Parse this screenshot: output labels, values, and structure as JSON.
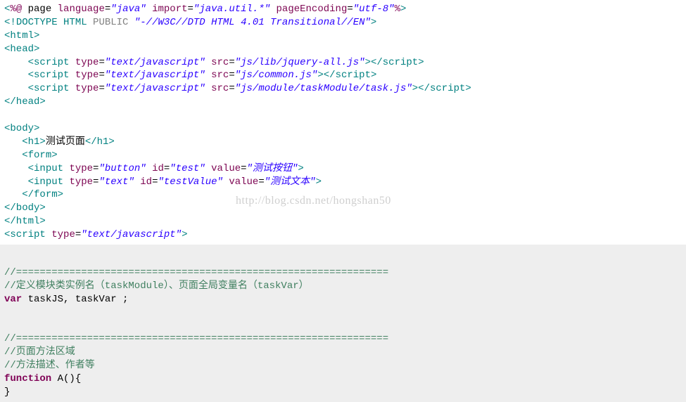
{
  "watermark": "http://blog.csdn.net/hongshan50",
  "jsp": {
    "line1": {
      "lt": "<",
      "pct": "%",
      "at": "@",
      "page_kw": " page ",
      "lang_attr": "language",
      "eq1": "=",
      "lang_val": "\"java\"",
      "import_attr": " import",
      "eq2": "=",
      "import_val": "\"java.util.*\"",
      "enc_attr": " pageEncoding",
      "eq3": "=",
      "enc_val": "\"utf-8\"",
      "pct2": "%",
      "gt": ">"
    },
    "line2": {
      "open": "<!",
      "doctype_kw": "DOCTYPE HTML",
      "public_kw": " PUBLIC ",
      "dtd": "\"-//W3C//DTD HTML 4.01 Transitional//EN\"",
      "close": ">"
    },
    "html_open": "<html>",
    "head_open": "<head>",
    "scripts": [
      {
        "indent": "    ",
        "open": "<",
        "tag": "script",
        "sp1": " ",
        "type_attr": "type",
        "eq1": "=",
        "type_val": "\"text/javascript\"",
        "sp2": " ",
        "src_attr": "src",
        "eq2": "=",
        "src_val": "\"js/lib/jquery-all.js\"",
        "close": "></",
        "tag2": "script",
        "gt": ">"
      },
      {
        "indent": "    ",
        "open": "<",
        "tag": "script",
        "sp1": " ",
        "type_attr": "type",
        "eq1": "=",
        "type_val": "\"text/javascript\"",
        "sp2": " ",
        "src_attr": "src",
        "eq2": "=",
        "src_val": "\"js/common.js\"",
        "close": "></",
        "tag2": "script",
        "gt": ">"
      },
      {
        "indent": "    ",
        "open": "<",
        "tag": "script",
        "sp1": " ",
        "type_attr": "type",
        "eq1": "=",
        "type_val": "\"text/javascript\"",
        "sp2": " ",
        "src_attr": "src",
        "eq2": "=",
        "src_val": "\"js/module/taskModule/task.js\"",
        "close": "></",
        "tag2": "script",
        "gt": ">"
      }
    ],
    "head_close": "</head>",
    "blank1": "",
    "body_open": "<body>",
    "h1": {
      "indent": "   ",
      "open": "<h1>",
      "text": "测试页面",
      "close": "</h1>"
    },
    "form_open": {
      "indent": "   ",
      "text": "<form>"
    },
    "input1": {
      "indent": "    ",
      "open": "<",
      "tag": "input",
      "sp1": " ",
      "type_attr": "type",
      "eq1": "=",
      "type_val": "\"button\"",
      "sp2": " ",
      "id_attr": "id",
      "eq2": "=",
      "id_val": "\"test\"",
      "sp3": " ",
      "val_attr": "value",
      "eq3": "=",
      "val_val": "\"测试按钮\"",
      "close": ">"
    },
    "input2": {
      "indent": "    ",
      "open": "<",
      "tag": "input",
      "sp1": " ",
      "type_attr": "type",
      "eq1": "=",
      "type_val": "\"text\"",
      "sp2": " ",
      "id_attr": "id",
      "eq2": "=",
      "id_val": "\"testValue\"",
      "sp3": " ",
      "val_attr": "value",
      "eq3": "=",
      "val_val": "\"测试文本\"",
      "close": ">"
    },
    "form_close": {
      "indent": "   ",
      "text": "</form>"
    },
    "body_close": "</body>",
    "html_close": "</html>",
    "script_open": {
      "open": "<",
      "tag": "script",
      "sp1": " ",
      "type_attr": "type",
      "eq1": "=",
      "type_val": "\"text/javascript\"",
      "close": ">"
    }
  },
  "js": {
    "sep1": "//===============================================================",
    "cmt1": "//定义模块类实例名（taskModule）、页面全局变量名（taskVar）",
    "var_kw": "var",
    "var_rest": " taskJS, taskVar ;",
    "blank2": "",
    "blank3": "",
    "sep2": "//===============================================================",
    "cmt2": "//页面方法区域",
    "cmt3": "//方法描述、作者等",
    "fn_kw": "function",
    "fn_rest": " A(){",
    "fn_close": "}"
  }
}
